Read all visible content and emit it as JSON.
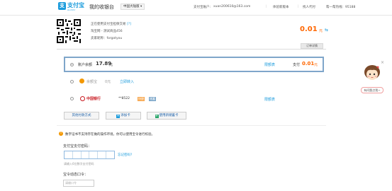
{
  "header": {
    "logo_glyph": "支",
    "logo_text": "支付宝",
    "logo_sub": "ALIPAY",
    "cashier_title": "我的收银台",
    "region": "中国大陆版",
    "region_chevron": "chevron-down-icon",
    "account_label": "支付宝账户:",
    "account_value": "xuan200610@163.com",
    "links": [
      "体验新版本",
      "找人代付",
      "帮一帮热线：95188"
    ],
    "separators": [
      "|",
      "|"
    ]
  },
  "order": {
    "lines": [
      "正在使用支付宝担保交易",
      "淘宝网 - 测试商品456",
      "卖家昵称：forgotyou"
    ],
    "help_mark": "[?]",
    "amount": "0.01",
    "amount_unit": "元",
    "detail_tab": "订单详情"
  },
  "payment": {
    "balance": {
      "label": "账户余额",
      "value": "17.89",
      "unit": "元",
      "limit_link": "限额表",
      "pay_label": "支付",
      "pay_amount": "0.01",
      "pay_unit": "元"
    },
    "yuebao": {
      "label": "余额宝",
      "value": "0元",
      "action": "立即转入"
    },
    "boc": {
      "name": "中国银行",
      "card": "**8522",
      "tag_express": "快捷",
      "tag_debit": "储蓄",
      "limit_link": "限额表"
    },
    "buttons": {
      "other": "其他付款方式",
      "add_card": "添加卡",
      "new_card": "使用新储蓄卡"
    }
  },
  "security": {
    "warn_glyph": "!",
    "warning": "数字证书不支持存在做的操作环境，你可以使用宝令进行校验。",
    "password_label": "支付宝支付密码：",
    "forgot": "忘记密码?",
    "password_hint": "请输入6位数字支付密码",
    "dynamic_label": "宝令动态口令：",
    "dynamic_placeholder": "请输口令"
  },
  "helper": {
    "close": "×",
    "label": "有问题点我~"
  },
  "colors": {
    "brand": "#1a9bdc",
    "amount": "#ff6600",
    "boc_red": "#c8161d"
  }
}
